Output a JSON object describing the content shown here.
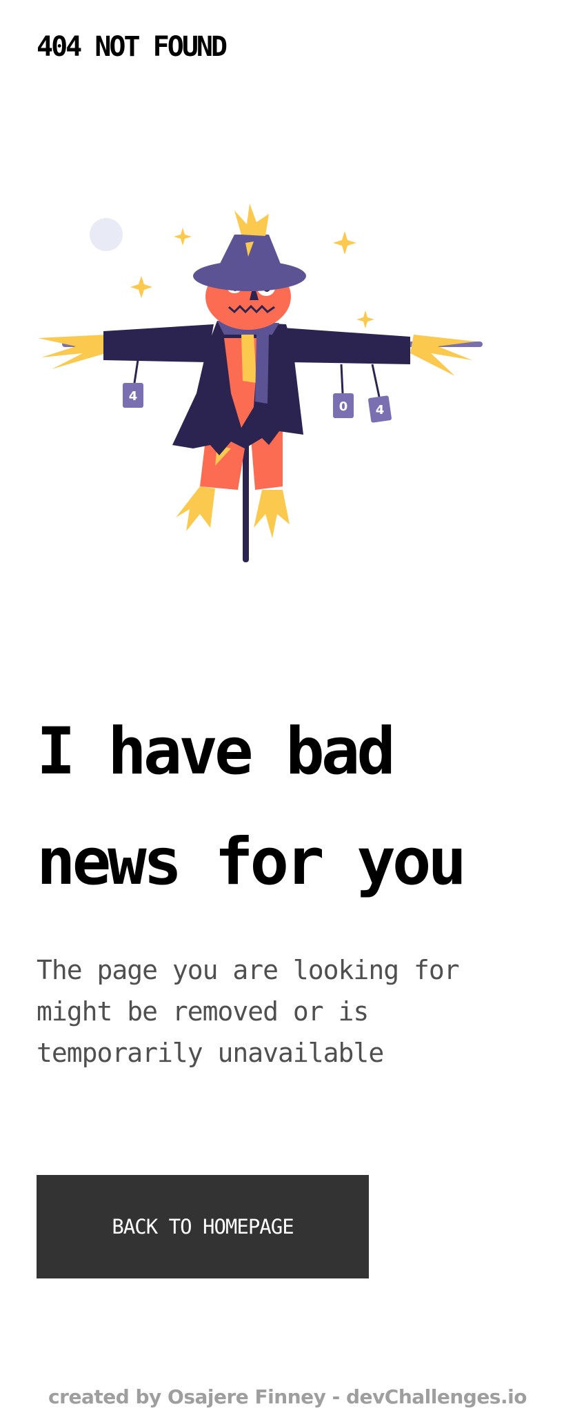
{
  "header": {
    "brand": "404 NOT FOUND"
  },
  "illustration": {
    "cans": [
      "4",
      "0",
      "4"
    ],
    "colors": {
      "hat": "#5b5393",
      "coat": "#2b2350",
      "face": "#fb6c52",
      "straw": "#fbc94e",
      "can": "#7a6fb0",
      "moon": "#e8ebf5"
    }
  },
  "main": {
    "headline_lines": [
      "I have bad",
      "news for you"
    ],
    "message_lines": [
      "The page you are looking for",
      "might be removed or is",
      "temporarily unavailable"
    ],
    "cta_label": "BACK TO HOMEPAGE"
  },
  "footer": {
    "credit": "created by Osajere Finney - devChallenges.io"
  }
}
